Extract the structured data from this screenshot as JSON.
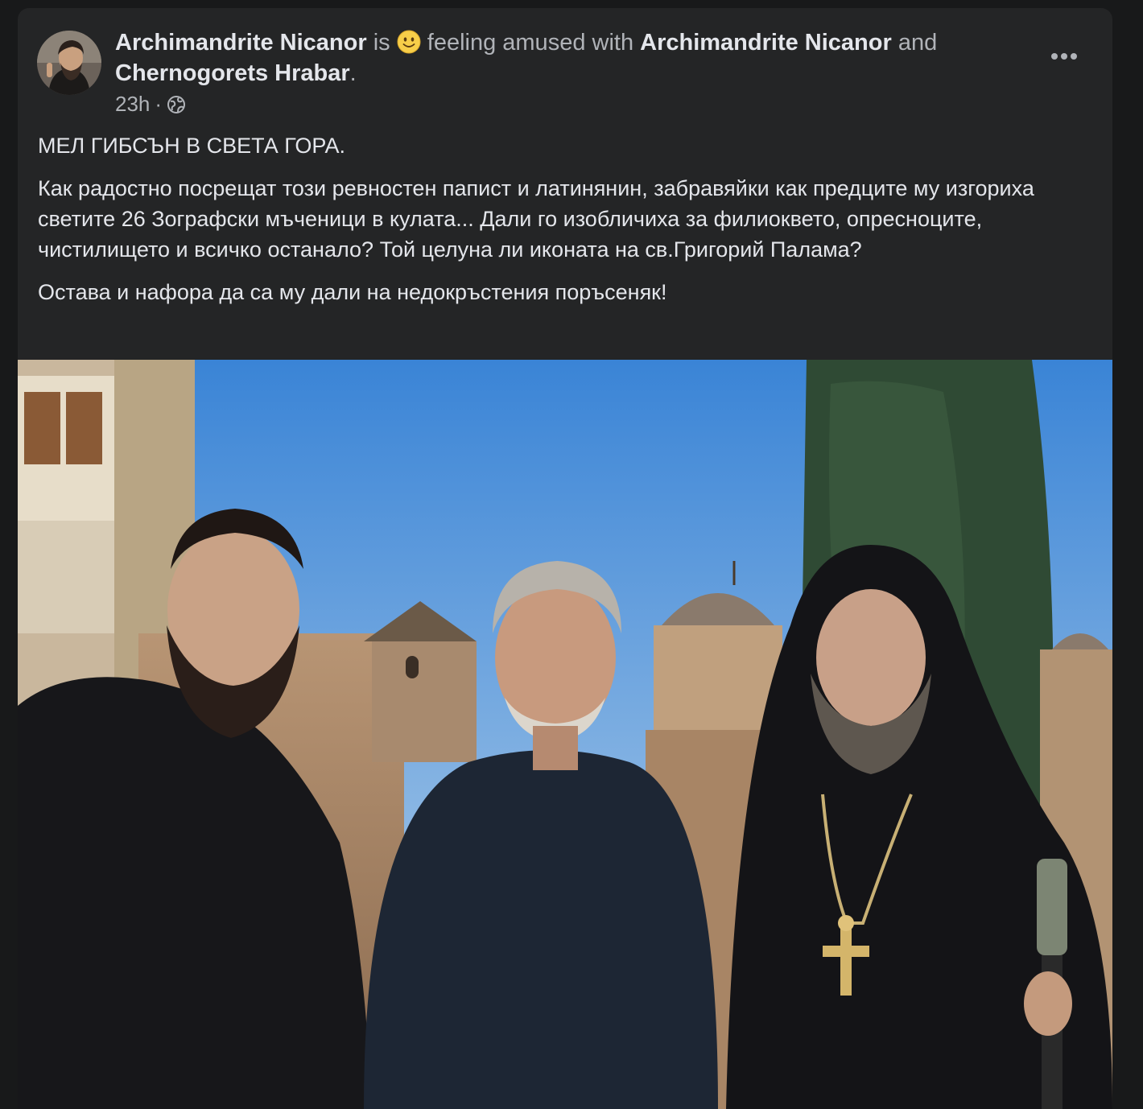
{
  "post": {
    "author": "Archimandrite Nicanor",
    "is_text": " is ",
    "feeling_text": " feeling amused with ",
    "tagged_1": "Archimandrite Nicanor",
    "and_text": " and",
    "tagged_2": "Chernogorets Hrabar",
    "period": ".",
    "time": "23h",
    "dot": "·",
    "privacy_icon": "globe-icon",
    "feeling_icon": "slightly-smiling-face-emoji",
    "more_icon": "more-horizontal-icon"
  },
  "content": {
    "title": "МЕЛ ГИБСЪН В СВЕТА ГОРА.",
    "paragraph_1": "Как радостно посрещат този ревностен папист и латинянин, забравяйки как предците му изгориха светите 26 Зографски мъченици в кулата... Дали го изобличиха за филиоквето, опресноците, чистилището и всичко останало? Той целуна ли иконата на св.Григорий Палама?",
    "paragraph_2": "Остава и нафора да са му дали на недокръстения поръсеняк!"
  },
  "colors": {
    "page_bg": "#18191a",
    "card_bg": "#242526",
    "primary_text": "#e4e6eb",
    "secondary_text": "#b0b3b8"
  }
}
